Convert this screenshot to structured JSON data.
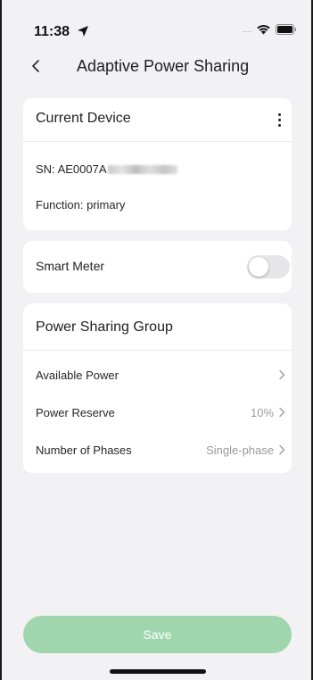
{
  "status_bar": {
    "time": "11:38",
    "signal": "....",
    "icons": [
      "location-arrow-icon",
      "wifi-icon",
      "battery-icon"
    ]
  },
  "nav": {
    "back_icon": "chevron-left-icon",
    "title": "Adaptive Power Sharing"
  },
  "current_device": {
    "heading": "Current Device",
    "sn_label": "SN: AE0007A",
    "function_text": "Function: primary",
    "menu_icon": "more-vertical-icon"
  },
  "smart_meter": {
    "label": "Smart Meter",
    "enabled": false
  },
  "power_sharing_group": {
    "heading": "Power Sharing Group",
    "rows": [
      {
        "label": "Available Power",
        "value": ""
      },
      {
        "label": "Power Reserve",
        "value": "10%"
      },
      {
        "label": "Number of Phases",
        "value": "Single-phase"
      }
    ]
  },
  "footer": {
    "save_label": "Save"
  },
  "colors": {
    "background": "#f2f2f4",
    "card": "#ffffff",
    "save_button": "#9fd6ae",
    "toggle_off": "#e6e6e8",
    "muted_text": "#9a9a9a"
  }
}
